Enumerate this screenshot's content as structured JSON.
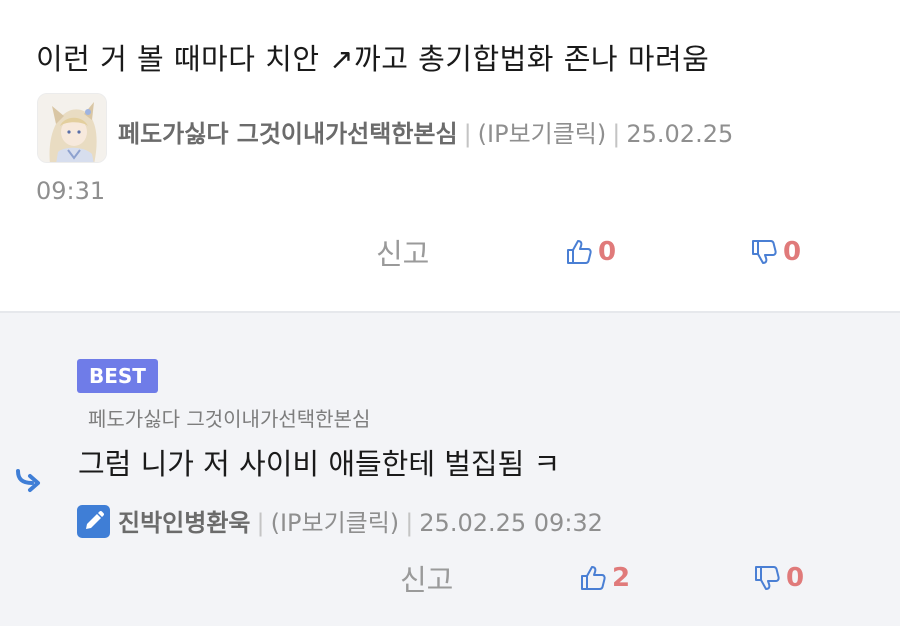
{
  "comment": {
    "text": "이런 거 볼 때마다 치안 ↗까고 총기합법화 존나 마려움",
    "author": "페도가싫다 그것이내가선택한본심",
    "ip_link": "(IP보기클릭)",
    "date": "25.02.25",
    "time": "09:31",
    "report_label": "신고",
    "upvotes": "0",
    "downvotes": "0"
  },
  "reply": {
    "badge": "BEST",
    "reply_to": "페도가싫다 그것이내가선택한본심",
    "text": "그럼 니가 저 사이비 애들한테 벌집됨 ㅋ",
    "author": "진박인병환욱",
    "ip_link": "(IP보기클릭)",
    "datetime": "25.02.25 09:32",
    "report_label": "신고",
    "upvotes": "2",
    "downvotes": "0"
  },
  "colors": {
    "accent_blue": "#3f7ed6",
    "badge_purple": "#6f7ce8",
    "count_red": "#e07a7a",
    "reply_bg": "#f3f4f7"
  },
  "icons": [
    "avatar-image",
    "thumbs-up-icon",
    "thumbs-down-icon",
    "reply-arrow-icon",
    "pencil-icon"
  ]
}
